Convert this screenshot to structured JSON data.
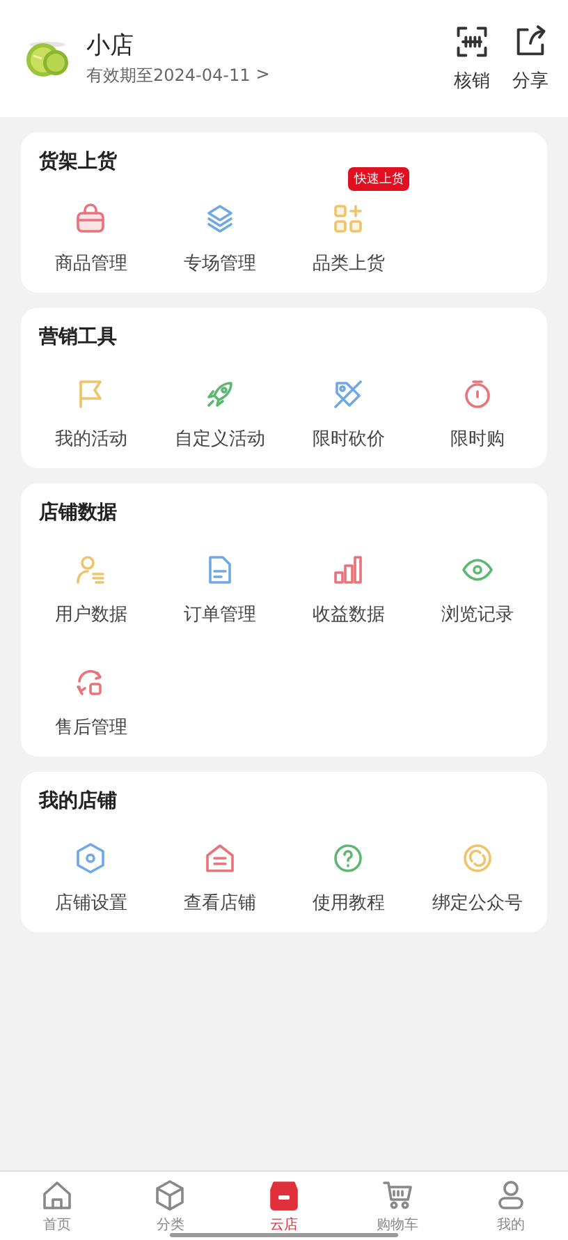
{
  "header": {
    "store_name": "小店",
    "validity": "有效期至2024-04-11",
    "validity_arrow": ">",
    "actions": [
      {
        "kind": "scan",
        "label": "核销"
      },
      {
        "kind": "share",
        "label": "分享"
      }
    ]
  },
  "sections": [
    {
      "title": "货架上货",
      "items": [
        {
          "kind": "bag",
          "color": "#e8737a",
          "label": "商品管理"
        },
        {
          "kind": "layers",
          "color": "#6fa8e6",
          "label": "专场管理"
        },
        {
          "kind": "grid",
          "color": "#f0c26a",
          "label": "品类上货",
          "badge": "快速上货"
        }
      ]
    },
    {
      "title": "营销工具",
      "items": [
        {
          "kind": "flag",
          "color": "#f0c26a",
          "label": "我的活动"
        },
        {
          "kind": "rocket",
          "color": "#5cb870",
          "label": "自定义活动"
        },
        {
          "kind": "tag",
          "color": "#6fa8e6",
          "label": "限时砍价"
        },
        {
          "kind": "timer",
          "color": "#e8737a",
          "label": "限时购"
        }
      ]
    },
    {
      "title": "店铺数据",
      "items": [
        {
          "kind": "user",
          "color": "#f0c26a",
          "label": "用户数据"
        },
        {
          "kind": "document",
          "color": "#6fa8e6",
          "label": "订单管理"
        },
        {
          "kind": "bars",
          "color": "#e8737a",
          "label": "收益数据"
        },
        {
          "kind": "eye",
          "color": "#5cb870",
          "label": "浏览记录"
        },
        {
          "kind": "refresh",
          "color": "#e8737a",
          "label": "售后管理"
        }
      ]
    },
    {
      "title": "我的店铺",
      "items": [
        {
          "kind": "hexagon",
          "color": "#6fa8e6",
          "label": "店铺设置"
        },
        {
          "kind": "house",
          "color": "#e8737a",
          "label": "查看店铺"
        },
        {
          "kind": "question",
          "color": "#5cb870",
          "label": "使用教程"
        },
        {
          "kind": "swirl",
          "color": "#f0c26a",
          "label": "绑定公众号"
        }
      ]
    }
  ],
  "tabs": [
    {
      "kind": "home",
      "label": "首页",
      "selected": false
    },
    {
      "kind": "cube",
      "label": "分类",
      "selected": false
    },
    {
      "kind": "store",
      "label": "云店",
      "selected": true
    },
    {
      "kind": "cart",
      "label": "购物车",
      "selected": false
    },
    {
      "kind": "person",
      "label": "我的",
      "selected": false
    }
  ]
}
